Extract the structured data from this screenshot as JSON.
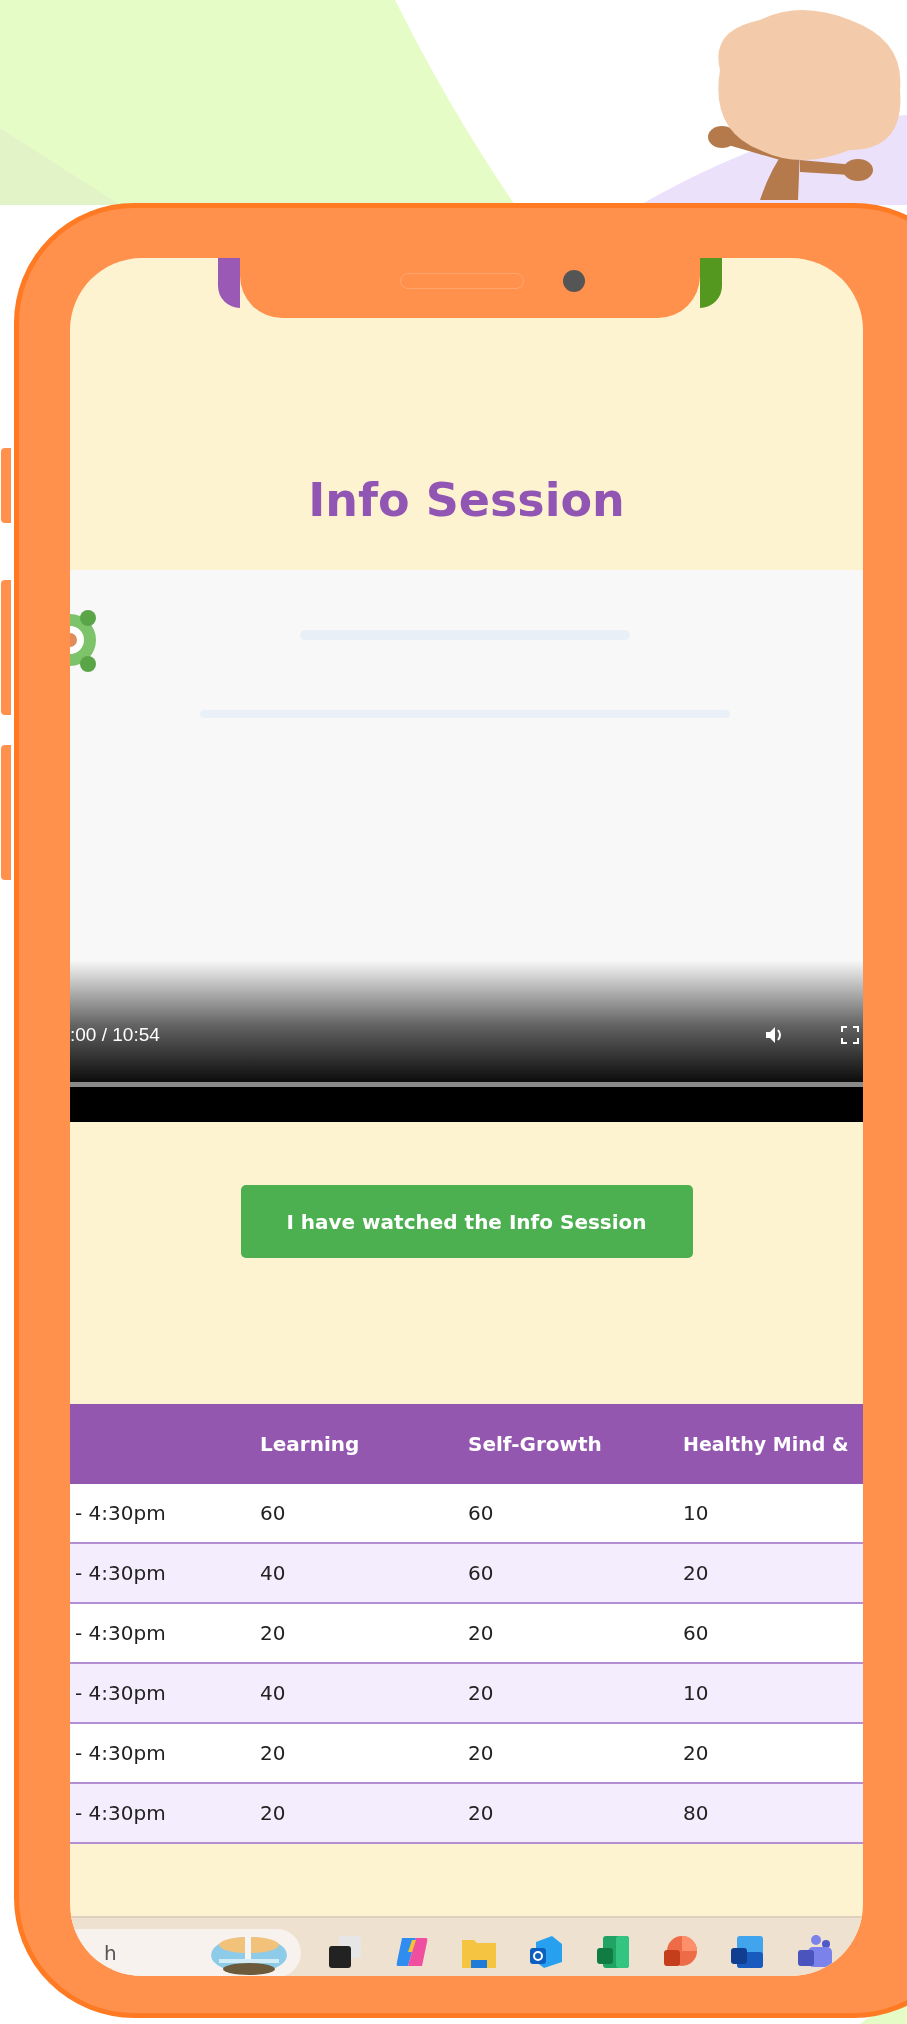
{
  "screen": {
    "title": "Info Session",
    "video": {
      "time": ":00 / 10:54",
      "level": 0
    },
    "button": {
      "label": "I have watched the Info Session"
    },
    "table": {
      "columns": [
        "",
        "Learning",
        "Self-Growth",
        "Healthy Mind &"
      ],
      "rows": [
        {
          "cells": [
            "- 4:30pm",
            "60",
            "60",
            "10"
          ]
        },
        {
          "cells": [
            "- 4:30pm",
            "40",
            "60",
            "20"
          ]
        },
        {
          "cells": [
            "- 4:30pm",
            "20",
            "20",
            "60"
          ]
        },
        {
          "cells": [
            "- 4:30pm",
            "40",
            "20",
            "10"
          ]
        },
        {
          "cells": [
            "- 4:30pm",
            "20",
            "20",
            "20"
          ]
        },
        {
          "cells": [
            "- 4:30pm",
            "20",
            "20",
            "80"
          ]
        }
      ]
    },
    "taskbar": {
      "search": {
        "placeholder": "h"
      }
    }
  }
}
